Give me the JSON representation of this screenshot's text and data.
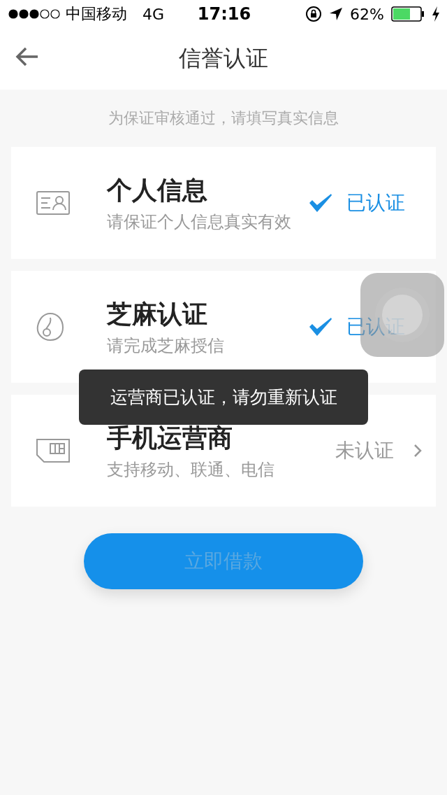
{
  "status_bar": {
    "carrier": "中国移动",
    "network": "4G",
    "time": "17:16",
    "battery_percent": "62%"
  },
  "nav": {
    "title": "信誉认证"
  },
  "hint": "为保证审核通过，请填写真实信息",
  "items": [
    {
      "kind": "id-card",
      "title": "个人信息",
      "subtitle": "请保证个人信息真实有效",
      "status": "已认证",
      "verified": true
    },
    {
      "kind": "sesame",
      "title": "芝麻认证",
      "subtitle": "请完成芝麻授信",
      "status": "已认证",
      "verified": true
    },
    {
      "kind": "sim",
      "title": "手机运营商",
      "subtitle": "支持移动、联通、电信",
      "status": "未认证",
      "verified": false
    }
  ],
  "button": {
    "label": "立即借款",
    "disabled": true
  },
  "toast": "运营商已认证，请勿重新认证"
}
